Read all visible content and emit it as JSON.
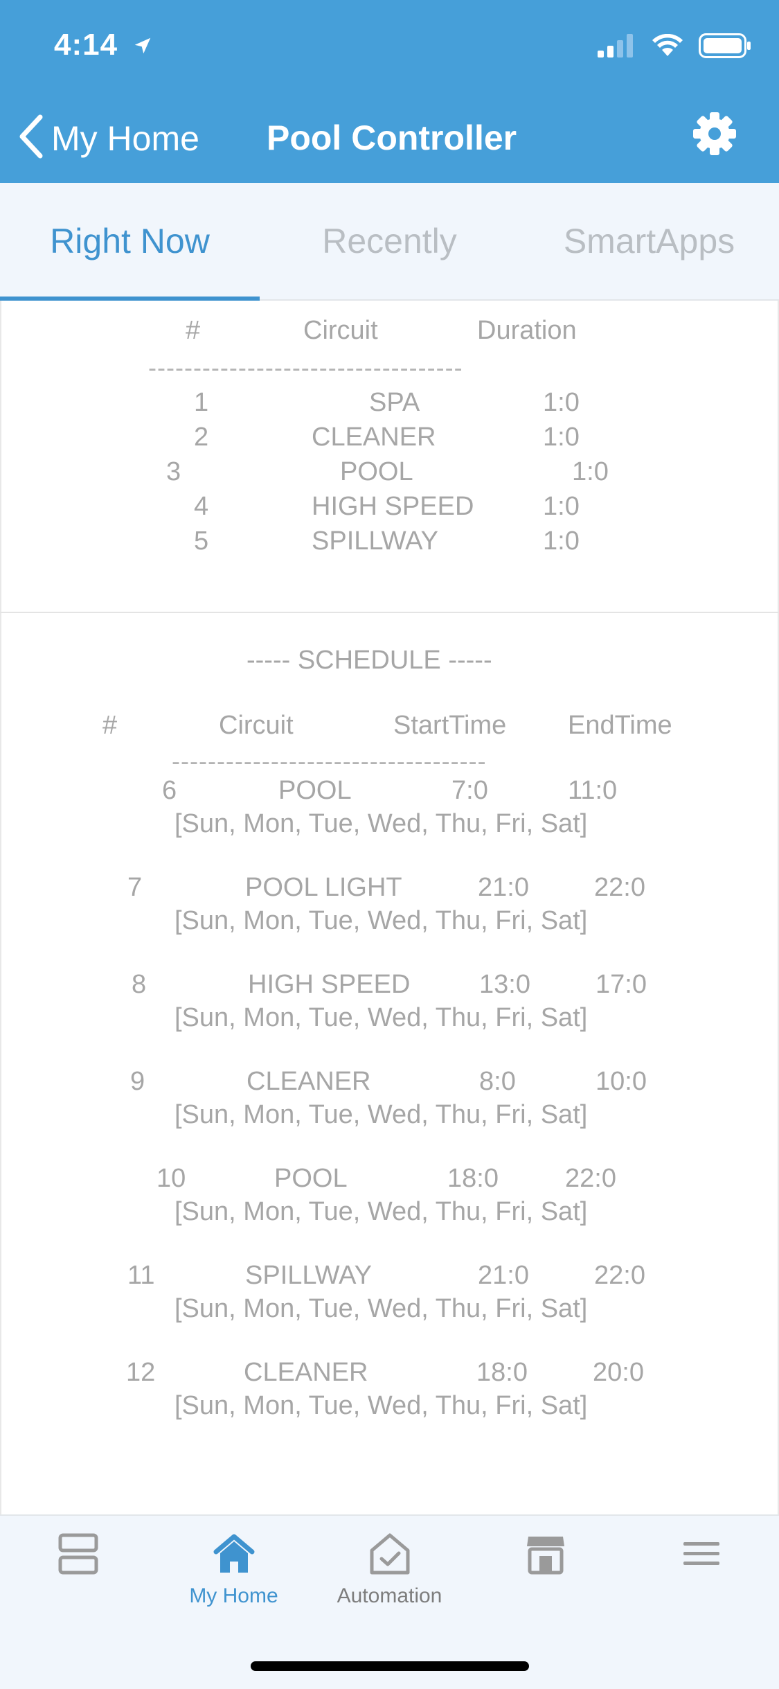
{
  "status_bar": {
    "time": "4:14"
  },
  "nav": {
    "back_label": "My Home",
    "title": "Pool Controller"
  },
  "tabs": [
    {
      "label": "Right Now"
    },
    {
      "label": "Recently"
    },
    {
      "label": "SmartApps"
    }
  ],
  "circuits": {
    "headers": {
      "num": "#",
      "circuit": "Circuit",
      "duration": "Duration"
    },
    "separator": "-----------------------------------",
    "rows": [
      {
        "num": "1",
        "circuit": "SPA",
        "duration": "1:0"
      },
      {
        "num": "2",
        "circuit": "CLEANER",
        "duration": "1:0"
      },
      {
        "num": "3",
        "circuit": "POOL",
        "duration": "1:0"
      },
      {
        "num": "4",
        "circuit": "HIGH SPEED",
        "duration": "1:0"
      },
      {
        "num": "5",
        "circuit": "SPILLWAY",
        "duration": "1:0"
      }
    ]
  },
  "schedule": {
    "title": "----- SCHEDULE -----",
    "headers": {
      "num": "#",
      "circuit": "Circuit",
      "start": "StartTime",
      "end": "EndTime"
    },
    "separator": "-----------------------------------",
    "rows": [
      {
        "num": "6",
        "circuit": "POOL",
        "start": "7:0",
        "end": "11:0",
        "days": "[Sun, Mon, Tue, Wed, Thu, Fri, Sat]"
      },
      {
        "num": "7",
        "circuit": "POOL LIGHT",
        "start": "21:0",
        "end": "22:0",
        "days": "[Sun, Mon, Tue, Wed, Thu, Fri, Sat]"
      },
      {
        "num": "8",
        "circuit": "HIGH SPEED",
        "start": "13:0",
        "end": "17:0",
        "days": "[Sun, Mon, Tue, Wed, Thu, Fri, Sat]"
      },
      {
        "num": "9",
        "circuit": "CLEANER",
        "start": "8:0",
        "end": "10:0",
        "days": "[Sun, Mon, Tue, Wed, Thu, Fri, Sat]"
      },
      {
        "num": "10",
        "circuit": "POOL",
        "start": "18:0",
        "end": "22:0",
        "days": "[Sun, Mon, Tue, Wed, Thu, Fri, Sat]"
      },
      {
        "num": "11",
        "circuit": "SPILLWAY",
        "start": "21:0",
        "end": "22:0",
        "days": "[Sun, Mon, Tue, Wed, Thu, Fri, Sat]"
      },
      {
        "num": "12",
        "circuit": "CLEANER",
        "start": "18:0",
        "end": "20:0",
        "days": "[Sun, Mon, Tue, Wed, Thu, Fri, Sat]"
      }
    ]
  },
  "tabbar": {
    "items": [
      {
        "label": "",
        "icon": "dashboard-icon"
      },
      {
        "label": "My Home",
        "icon": "home-icon"
      },
      {
        "label": "Automation",
        "icon": "automation-icon"
      },
      {
        "label": "",
        "icon": "marketplace-icon"
      },
      {
        "label": "",
        "icon": "menu-icon"
      }
    ]
  },
  "colors": {
    "header": "#469fd9",
    "accent": "#3f93cf",
    "text_gray": "#a6a6a6",
    "tab_bg": "#f1f6fc"
  }
}
